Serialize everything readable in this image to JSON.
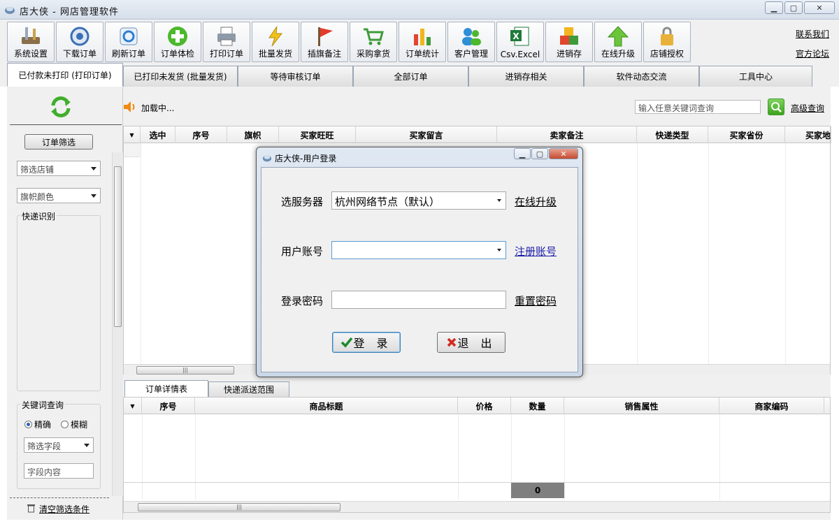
{
  "window": {
    "title": "店大侠 - 网店管理软件"
  },
  "toolbar": {
    "buttons": [
      {
        "label": "系统设置",
        "icon": "settings-tools-icon"
      },
      {
        "label": "下载订单",
        "icon": "download-icon"
      },
      {
        "label": "刷新订单",
        "icon": "refresh-icon"
      },
      {
        "label": "订单体检",
        "icon": "plus-circle-icon"
      },
      {
        "label": "打印订单",
        "icon": "printer-icon"
      },
      {
        "label": "批量发货",
        "icon": "lightning-icon"
      },
      {
        "label": "插旗备注",
        "icon": "flag-icon"
      },
      {
        "label": "采购拿货",
        "icon": "cart-icon"
      },
      {
        "label": "订单统计",
        "icon": "bar-chart-icon"
      },
      {
        "label": "客户管理",
        "icon": "users-icon"
      },
      {
        "label": "Csv.Excel",
        "icon": "excel-icon"
      },
      {
        "label": "进销存",
        "icon": "boxes-icon"
      },
      {
        "label": "在线升级",
        "icon": "up-arrow-icon"
      },
      {
        "label": "店铺授权",
        "icon": "lock-icon"
      }
    ],
    "links": {
      "contact": "联系我们",
      "forum": "官方论坛"
    }
  },
  "tabs": [
    "已付款未打印 (打印订单)",
    "已打印未发货 (批量发货)",
    "等待审核订单",
    "全部订单",
    "进销存相关",
    "软件动态交流",
    "工具中心"
  ],
  "sidebar": {
    "filter_button": "订单筛选",
    "shop_select": "筛选店铺",
    "flag_select": "旗帜颜色",
    "express_group": "快递识别",
    "keyword_group": "关键词查询",
    "radio_exact": "精确",
    "radio_fuzzy": "模糊",
    "field_select": "筛选字段",
    "field_placeholder": "字段内容",
    "clear_link": "清空筛选条件"
  },
  "main": {
    "loading": "加载中...",
    "search_placeholder": "输入任意关键词查询",
    "advanced_link": "高级查询",
    "columns": [
      "选中",
      "序号",
      "旗帜",
      "买家旺旺",
      "买家留言",
      "卖家备注",
      "快递类型",
      "买家省份",
      "买家地"
    ]
  },
  "detail": {
    "tabs": [
      "订单详情表",
      "快递派送范围"
    ],
    "columns": [
      "序号",
      "商品标题",
      "价格",
      "数量",
      "销售属性",
      "商家编码"
    ],
    "quantity_sum": "0"
  },
  "login_dialog": {
    "title": "店大侠-用户登录",
    "server_label": "选服务器",
    "server_value": "杭州网络节点（默认）",
    "upgrade_link": "在线升级",
    "account_label": "用户账号",
    "account_value": "",
    "register_link": "注册账号",
    "password_label": "登录密码",
    "reset_link": "重置密码",
    "login_button": "登 录",
    "exit_button": "退 出"
  }
}
